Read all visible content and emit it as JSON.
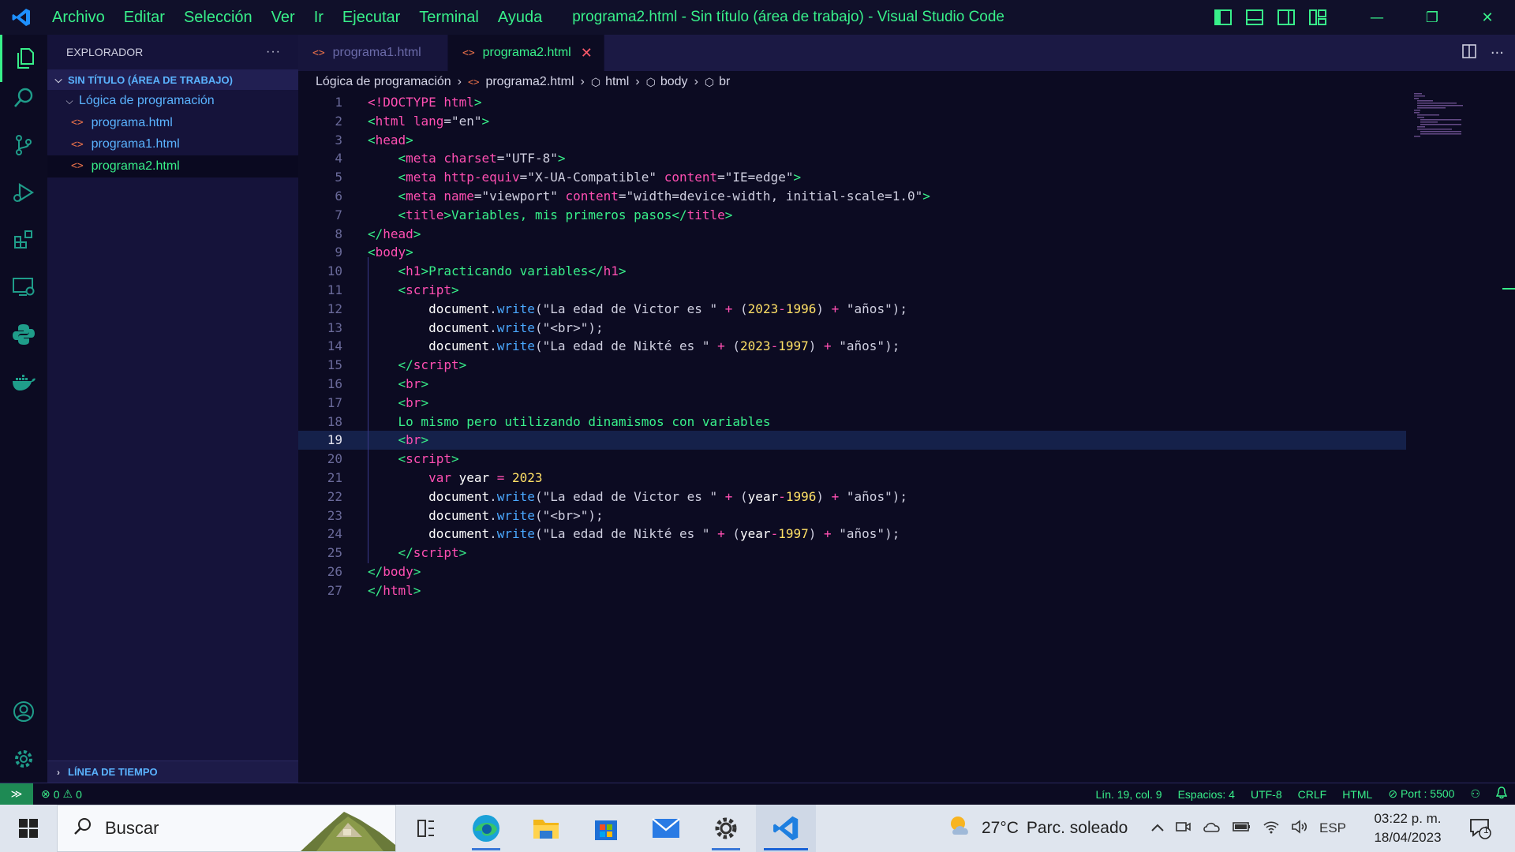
{
  "titlebar": {
    "menu": [
      "Archivo",
      "Editar",
      "Selección",
      "Ver",
      "Ir",
      "Ejecutar",
      "Terminal",
      "Ayuda"
    ],
    "window_title": "programa2.html - Sin título (área de trabajo) - Visual Studio Code",
    "minimize": "—",
    "restore": "❐",
    "close": "✕"
  },
  "activitybar": {
    "icons": [
      "explorer-icon",
      "search-icon",
      "source-control-icon",
      "run-debug-icon",
      "extensions-icon",
      "remote-explorer-icon",
      "python-icon",
      "docker-icon",
      "account-icon",
      "settings-icon"
    ]
  },
  "sidebar": {
    "title": "EXPLORADOR",
    "more": "···",
    "workspace": "SIN TÍTULO (ÁREA DE TRABAJO)",
    "folder": "Lógica de programación",
    "files": [
      "programa.html",
      "programa1.html",
      "programa2.html"
    ],
    "active_file": "programa2.html",
    "timeline": "LÍNEA DE TIEMPO"
  },
  "tabs": [
    {
      "label": "programa1.html",
      "active": false
    },
    {
      "label": "programa2.html",
      "active": true
    }
  ],
  "breadcrumb": [
    "Lógica de programación",
    "programa2.html",
    "html",
    "body",
    "br"
  ],
  "editor": {
    "current_line": 19,
    "lines": [
      [
        [
          "t-tag",
          "<!DOCTYPE "
        ],
        [
          "t-tag",
          "html"
        ],
        [
          "t-br",
          ">"
        ]
      ],
      [
        [
          "t-br",
          "<"
        ],
        [
          "t-tag",
          "html "
        ],
        [
          "t-attr",
          "lang"
        ],
        [
          "t-str",
          "=\"en\""
        ],
        [
          "t-br",
          ">"
        ]
      ],
      [
        [
          "t-br",
          "<"
        ],
        [
          "t-tag",
          "head"
        ],
        [
          "t-br",
          ">"
        ]
      ],
      [
        [
          "t-txt",
          "    "
        ],
        [
          "t-br",
          "<"
        ],
        [
          "t-tag",
          "meta "
        ],
        [
          "t-attr",
          "charset"
        ],
        [
          "t-str",
          "=\"UTF-8\""
        ],
        [
          "t-br",
          ">"
        ]
      ],
      [
        [
          "t-txt",
          "    "
        ],
        [
          "t-br",
          "<"
        ],
        [
          "t-tag",
          "meta "
        ],
        [
          "t-attr",
          "http-equiv"
        ],
        [
          "t-str",
          "=\"X-UA-Compatible\" "
        ],
        [
          "t-attr",
          "content"
        ],
        [
          "t-str",
          "=\"IE=edge\""
        ],
        [
          "t-br",
          ">"
        ]
      ],
      [
        [
          "t-txt",
          "    "
        ],
        [
          "t-br",
          "<"
        ],
        [
          "t-tag",
          "meta "
        ],
        [
          "t-attr",
          "name"
        ],
        [
          "t-str",
          "=\"viewport\" "
        ],
        [
          "t-attr",
          "content"
        ],
        [
          "t-str",
          "=\"width=device-width, initial-scale=1.0\""
        ],
        [
          "t-br",
          ">"
        ]
      ],
      [
        [
          "t-txt",
          "    "
        ],
        [
          "t-br",
          "<"
        ],
        [
          "t-tag",
          "title"
        ],
        [
          "t-br",
          ">"
        ],
        [
          "t-txt",
          "Variables, mis primeros pasos"
        ],
        [
          "t-br",
          "</"
        ],
        [
          "t-tag",
          "title"
        ],
        [
          "t-br",
          ">"
        ]
      ],
      [
        [
          "t-br",
          "</"
        ],
        [
          "t-tag",
          "head"
        ],
        [
          "t-br",
          ">"
        ]
      ],
      [
        [
          "t-br",
          "<"
        ],
        [
          "t-tag",
          "body"
        ],
        [
          "t-br",
          ">"
        ]
      ],
      [
        [
          "t-txt",
          "    "
        ],
        [
          "t-br",
          "<"
        ],
        [
          "t-tag",
          "h1"
        ],
        [
          "t-br",
          ">"
        ],
        [
          "t-txt",
          "Practicando variables"
        ],
        [
          "t-br",
          "</"
        ],
        [
          "t-tag",
          "h1"
        ],
        [
          "t-br",
          ">"
        ]
      ],
      [
        [
          "t-txt",
          "    "
        ],
        [
          "t-br",
          "<"
        ],
        [
          "t-tag",
          "script"
        ],
        [
          "t-br",
          ">"
        ]
      ],
      [
        [
          "t-txt",
          "        "
        ],
        [
          "t-doc",
          "document"
        ],
        [
          "t-str",
          "."
        ],
        [
          "t-fn",
          "write"
        ],
        [
          "t-str",
          "(\"La edad de Victor es \" "
        ],
        [
          "t-op",
          "+ "
        ],
        [
          "t-str",
          "("
        ],
        [
          "t-num",
          "2023"
        ],
        [
          "t-op",
          "-"
        ],
        [
          "t-num",
          "1996"
        ],
        [
          "t-str",
          ") "
        ],
        [
          "t-op",
          "+ "
        ],
        [
          "t-str",
          "\"años\");"
        ]
      ],
      [
        [
          "t-txt",
          "        "
        ],
        [
          "t-doc",
          "document"
        ],
        [
          "t-str",
          "."
        ],
        [
          "t-fn",
          "write"
        ],
        [
          "t-str",
          "(\"<br>\");"
        ]
      ],
      [
        [
          "t-txt",
          "        "
        ],
        [
          "t-doc",
          "document"
        ],
        [
          "t-str",
          "."
        ],
        [
          "t-fn",
          "write"
        ],
        [
          "t-str",
          "(\"La edad de Nikté es \" "
        ],
        [
          "t-op",
          "+ "
        ],
        [
          "t-str",
          "("
        ],
        [
          "t-num",
          "2023"
        ],
        [
          "t-op",
          "-"
        ],
        [
          "t-num",
          "1997"
        ],
        [
          "t-str",
          ") "
        ],
        [
          "t-op",
          "+ "
        ],
        [
          "t-str",
          "\"años\");"
        ]
      ],
      [
        [
          "t-txt",
          "    "
        ],
        [
          "t-br",
          "</"
        ],
        [
          "t-tag",
          "script"
        ],
        [
          "t-br",
          ">"
        ]
      ],
      [
        [
          "t-txt",
          "    "
        ],
        [
          "t-br",
          "<"
        ],
        [
          "t-tag",
          "br"
        ],
        [
          "t-br",
          ">"
        ]
      ],
      [
        [
          "t-txt",
          "    "
        ],
        [
          "t-br",
          "<"
        ],
        [
          "t-tag",
          "br"
        ],
        [
          "t-br",
          ">"
        ]
      ],
      [
        [
          "t-txt",
          "    Lo mismo pero utilizando dinamismos con variables"
        ]
      ],
      [
        [
          "t-txt",
          "    "
        ],
        [
          "t-br",
          "<"
        ],
        [
          "t-tag",
          "br"
        ],
        [
          "t-br",
          ">"
        ]
      ],
      [
        [
          "t-txt",
          "    "
        ],
        [
          "t-br",
          "<"
        ],
        [
          "t-tag",
          "script"
        ],
        [
          "t-br",
          ">"
        ]
      ],
      [
        [
          "t-txt",
          "        "
        ],
        [
          "t-tag",
          "var "
        ],
        [
          "t-var",
          "year "
        ],
        [
          "t-op",
          "= "
        ],
        [
          "t-num",
          "2023"
        ]
      ],
      [
        [
          "t-txt",
          "        "
        ],
        [
          "t-doc",
          "document"
        ],
        [
          "t-str",
          "."
        ],
        [
          "t-fn",
          "write"
        ],
        [
          "t-str",
          "(\"La edad de Victor es \" "
        ],
        [
          "t-op",
          "+ "
        ],
        [
          "t-str",
          "("
        ],
        [
          "t-var",
          "year"
        ],
        [
          "t-op",
          "-"
        ],
        [
          "t-num",
          "1996"
        ],
        [
          "t-str",
          ") "
        ],
        [
          "t-op",
          "+ "
        ],
        [
          "t-str",
          "\"años\");"
        ]
      ],
      [
        [
          "t-txt",
          "        "
        ],
        [
          "t-doc",
          "document"
        ],
        [
          "t-str",
          "."
        ],
        [
          "t-fn",
          "write"
        ],
        [
          "t-str",
          "(\"<br>\");"
        ]
      ],
      [
        [
          "t-txt",
          "        "
        ],
        [
          "t-doc",
          "document"
        ],
        [
          "t-str",
          "."
        ],
        [
          "t-fn",
          "write"
        ],
        [
          "t-str",
          "(\"La edad de Nikté es \" "
        ],
        [
          "t-op",
          "+ "
        ],
        [
          "t-str",
          "("
        ],
        [
          "t-var",
          "year"
        ],
        [
          "t-op",
          "-"
        ],
        [
          "t-num",
          "1997"
        ],
        [
          "t-str",
          ") "
        ],
        [
          "t-op",
          "+ "
        ],
        [
          "t-str",
          "\"años\");"
        ]
      ],
      [
        [
          "t-txt",
          "    "
        ],
        [
          "t-br",
          "</"
        ],
        [
          "t-tag",
          "script"
        ],
        [
          "t-br",
          ">"
        ]
      ],
      [
        [
          "t-br",
          "</"
        ],
        [
          "t-tag",
          "body"
        ],
        [
          "t-br",
          ">"
        ]
      ],
      [
        [
          "t-br",
          "</"
        ],
        [
          "t-tag",
          "html"
        ],
        [
          "t-br",
          ">"
        ]
      ]
    ]
  },
  "statusbar": {
    "remote": "≫",
    "errors": "0",
    "warnings": "0",
    "position": "Lín. 19, col. 9",
    "spaces": "Espacios: 4",
    "encoding": "UTF-8",
    "eol": "CRLF",
    "language": "HTML",
    "port": "Port : 5500"
  },
  "taskbar": {
    "search_placeholder": "Buscar",
    "weather_temp": "27°C",
    "weather_desc": "Parc. soleado",
    "language": "ESP",
    "time": "03:22 p. m.",
    "date": "18/04/2023",
    "notifications": "1"
  },
  "colors": {
    "accent": "#38f08a",
    "background": "#0c0b22",
    "sidebar": "#15133a",
    "link": "#5ab3ff",
    "tag": "#ff4fb2"
  }
}
